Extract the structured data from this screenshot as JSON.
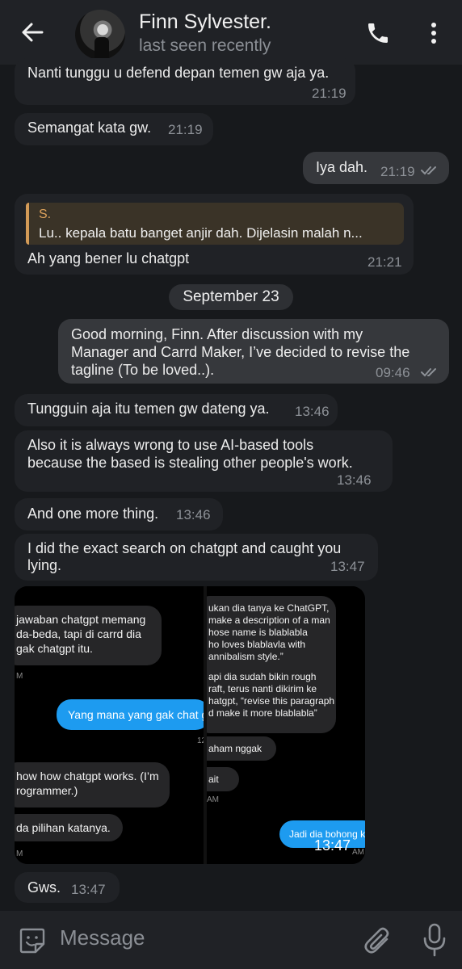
{
  "header": {
    "title": "Finn Sylvester.",
    "subtitle": "last seen recently",
    "icons": {
      "back": "back-arrow-icon",
      "call": "phone-icon",
      "menu": "more-vert-icon"
    }
  },
  "messages": [
    {
      "text": "Nanti tunggu u defend depan temen gw aja ya.",
      "time": "21:19"
    },
    {
      "text": "Semangat kata gw.",
      "time": "21:19"
    },
    {
      "text": "Iya dah.",
      "time": "21:19"
    },
    {
      "reply_author": "S.",
      "reply_text": "Lu.. kepala batu banget anjir dah. Dijelasin malah n...",
      "text": "Ah yang bener lu chatgpt",
      "time": "21:21"
    },
    {
      "text_lines": [
        "Good morning, Finn. After discussion with my",
        "Manager and Carrd Maker, I’ve decided to revise the",
        "tagline (To be loved..)."
      ],
      "time": "09:46"
    },
    {
      "text": "Tungguin aja itu temen gw dateng ya.",
      "time": "13:46"
    },
    {
      "text_lines": [
        "Also it is always wrong to use AI-based tools",
        "because the based is stealing other people's work."
      ],
      "time": "13:46"
    },
    {
      "text": "And one more thing.",
      "time": "13:46"
    },
    {
      "text_lines": [
        "I did the exact search on chatgpt and caught you",
        "lying."
      ],
      "time": "13:47"
    },
    {
      "photo_time": "13:47"
    },
    {
      "text": "Gws.",
      "time": "13:47"
    }
  ],
  "date_separator": "September 23",
  "screenshot_left": {
    "bubble1": [
      "jawaban chatgpt memang",
      "da-beda, tapi di carrd dia",
      "gak chatgpt itu."
    ],
    "m1": "M",
    "blue": "Yang mana yang gak chat g",
    "m2": "12",
    "bubble2": [
      "how how chatgpt works. (I’m",
      "rogrammer.)"
    ],
    "bubble3": "da pilihan katanya.",
    "m3": "M"
  },
  "screenshot_right": {
    "bubble1": [
      "ukan dia tanya ke ChatGPT,",
      "make a description of a man",
      "hose name is blablabla",
      "ho loves blablavla with",
      "annibalism style.”",
      "",
      "api dia sudah bikin rough",
      "raft, terus nanti dikirim ke",
      "hatgpt, “revise this paragraph",
      "d make it more blablabla”"
    ],
    "bubble2": "aham nggak",
    "bubble3": "ait",
    "m1": "AM",
    "blue": "Jadi dia bohong ka",
    "m2": "AM"
  },
  "composer": {
    "placeholder": "Message",
    "icons": {
      "sticker": "sticker-icon",
      "attach": "paperclip-icon",
      "mic": "microphone-icon"
    }
  },
  "colors": {
    "header_bg": "#202226",
    "outgoing_bubble": "#36383c",
    "incoming_bubble": "#202226",
    "quote_accent": "#d39a57",
    "x_blue": "#1d9bf0"
  }
}
